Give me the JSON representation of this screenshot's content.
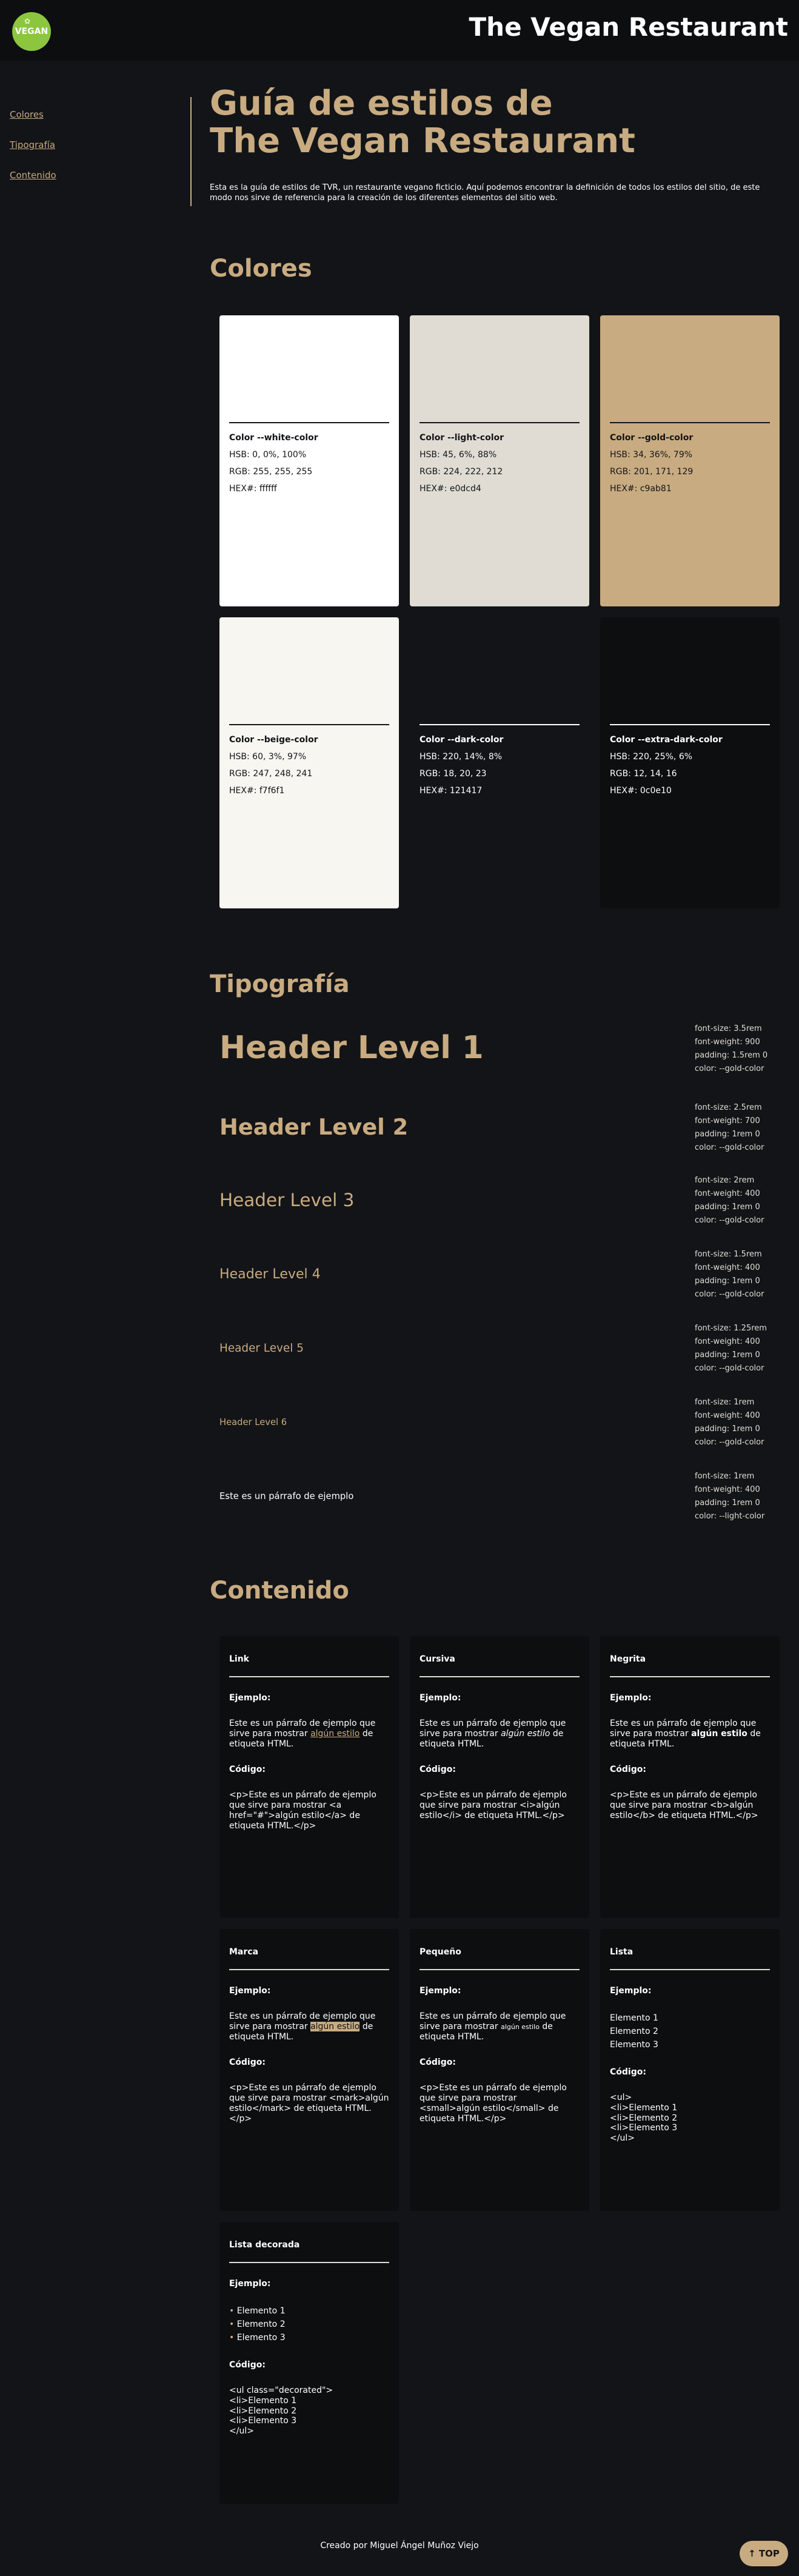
{
  "header": {
    "logo_text": "VEGAN",
    "logo_leaf": "✿",
    "site_title": "The Vegan Restaurant"
  },
  "nav": {
    "items": [
      "Colores",
      "Tipografía",
      "Contenido"
    ]
  },
  "hero": {
    "title_line1": "Guía de estilos de",
    "title_line2": "The Vegan Restaurant",
    "description": "Esta es la guía de estilos de TVR, un restaurante vegano ficticio. Aquí podemos encontrar la definición de todos los estilos del sitio, de este modo nos sirve de referencia para la creación de los diferentes elementos del sitio web."
  },
  "colors": {
    "section_title": "Colores",
    "swatches": [
      {
        "name": "Color --white-color",
        "hsb": "HSB: 0, 0%, 100%",
        "rgb": "RGB: 255, 255, 255",
        "hex": "HEX#: ffffff",
        "bg": "#ffffff",
        "fg": "#121417"
      },
      {
        "name": "Color --light-color",
        "hsb": "HSB: 45, 6%, 88%",
        "rgb": "RGB: 224, 222, 212",
        "hex": "HEX#: e0dcd4",
        "bg": "#e0dcd4",
        "fg": "#121417"
      },
      {
        "name": "Color --gold-color",
        "hsb": "HSB: 34, 36%, 79%",
        "rgb": "RGB: 201, 171, 129",
        "hex": "HEX#: c9ab81",
        "bg": "#c9ab81",
        "fg": "#121417"
      },
      {
        "name": "Color --beige-color",
        "hsb": "HSB: 60, 3%, 97%",
        "rgb": "RGB: 247, 248, 241",
        "hex": "HEX#: f7f6f1",
        "bg": "#f7f6f1",
        "fg": "#121417"
      },
      {
        "name": "Color --dark-color",
        "hsb": "HSB: 220, 14%, 8%",
        "rgb": "RGB: 18, 20, 23",
        "hex": "HEX#: 121417",
        "bg": "#121417",
        "fg": "#ffffff"
      },
      {
        "name": "Color --extra-dark-color",
        "hsb": "HSB: 220, 25%, 6%",
        "rgb": "RGB: 12, 14, 16",
        "hex": "HEX#: 0c0e10",
        "bg": "#0c0e10",
        "fg": "#ffffff"
      }
    ]
  },
  "typography": {
    "section_title": "Tipografía",
    "rows": [
      {
        "sample": "Header Level 1",
        "size": "font-size: 3.5rem",
        "weight": "font-weight: 900",
        "padding": "padding: 1.5rem 0",
        "color": "color: --gold-color"
      },
      {
        "sample": "Header Level 2",
        "size": "font-size: 2.5rem",
        "weight": "font-weight: 700",
        "padding": "padding: 1rem 0",
        "color": "color: --gold-color"
      },
      {
        "sample": "Header Level 3",
        "size": "font-size: 2rem",
        "weight": "font-weight: 400",
        "padding": "padding: 1rem 0",
        "color": "color: --gold-color"
      },
      {
        "sample": "Header Level 4",
        "size": "font-size: 1.5rem",
        "weight": "font-weight: 400",
        "padding": "padding: 1rem 0",
        "color": "color: --gold-color"
      },
      {
        "sample": "Header Level 5",
        "size": "font-size: 1.25rem",
        "weight": "font-weight: 400",
        "padding": "padding: 1rem 0",
        "color": "color: --gold-color"
      },
      {
        "sample": "Header Level 6",
        "size": "font-size: 1rem",
        "weight": "font-weight: 400",
        "padding": "padding: 1rem 0",
        "color": "color: --gold-color"
      },
      {
        "sample": "Este es un párrafo de ejemplo",
        "size": "font-size: 1rem",
        "weight": "font-weight: 400",
        "padding": "padding: 1rem 0",
        "color": "color: --light-color"
      }
    ]
  },
  "content": {
    "section_title": "Contenido",
    "example_label": "Ejemplo:",
    "code_label": "Código:",
    "cards": [
      {
        "title": "Link",
        "ex_pre": "Este es un párrafo de ejemplo que sirve para mostrar ",
        "ex_mid": "algún estilo",
        "ex_post": " de etiqueta HTML.",
        "code": "<p>Este es un párrafo de ejemplo que sirve para mostrar <a href=\"#\">algún estilo</a> de etiqueta HTML.</p>"
      },
      {
        "title": "Cursiva",
        "ex_pre": "Este es un párrafo de ejemplo que sirve para mostrar ",
        "ex_mid": "algún estilo",
        "ex_post": " de etiqueta HTML.",
        "code": "<p>Este es un párrafo de ejemplo que sirve para mostrar <i>algún estilo</i> de etiqueta HTML.</p>"
      },
      {
        "title": "Negrita",
        "ex_pre": "Este es un párrafo de ejemplo que sirve para mostrar ",
        "ex_mid": "algún estilo",
        "ex_post": " de etiqueta HTML.",
        "code": "<p>Este es un párrafo de ejemplo que sirve para mostrar <b>algún estilo</b> de etiqueta HTML.</p>"
      },
      {
        "title": "Marca",
        "ex_pre": "Este es un párrafo de ejemplo que sirve para mostrar ",
        "ex_mid": "algún estilo",
        "ex_post": " de etiqueta HTML.",
        "code": "<p>Este es un párrafo de ejemplo que sirve para mostrar <mark>algún estilo</mark> de etiqueta HTML.</p>"
      },
      {
        "title": "Pequeño",
        "ex_pre": "Este es un párrafo de ejemplo que sirve para mostrar ",
        "ex_mid": "algún estilo",
        "ex_post": " de etiqueta HTML.",
        "code": "<p>Este es un párrafo de ejemplo que sirve para mostrar <small>algún estilo</small> de etiqueta HTML.</p>"
      },
      {
        "title": "Lista",
        "items": [
          "Elemento 1",
          "Elemento 2",
          "Elemento 3"
        ],
        "code": "<ul>\n<li>Elemento 1\n<li>Elemento 2\n<li>Elemento 3\n</ul>"
      },
      {
        "title": "Lista decorada",
        "items": [
          "Elemento 1",
          "Elemento 2",
          "Elemento 3"
        ],
        "code": "<ul class=\"decorated\">\n<li>Elemento 1\n<li>Elemento 2\n<li>Elemento 3\n</ul>"
      }
    ]
  },
  "footer": {
    "credit": "Creado por Miguel Ángel Muñoz Viejo",
    "top_button": "↑ TOP"
  }
}
